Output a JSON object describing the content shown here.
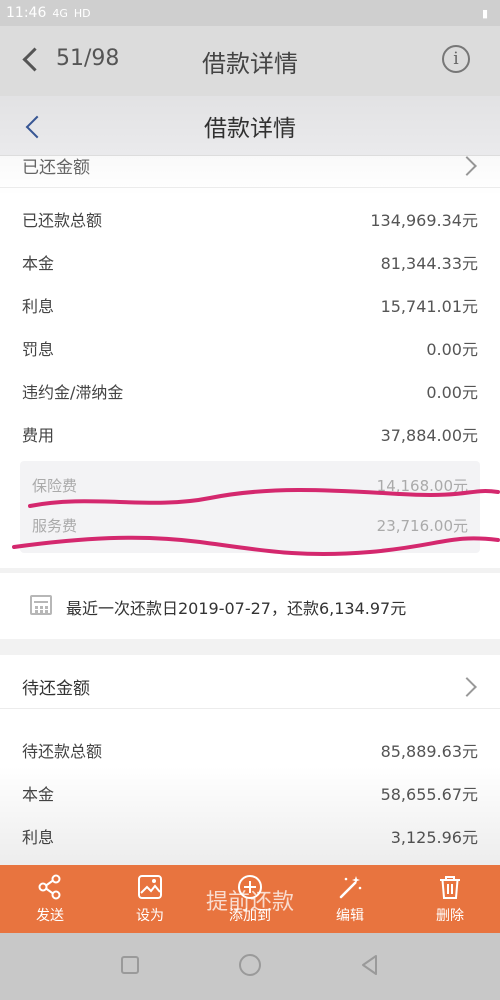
{
  "statusbar": {
    "time": "11:46",
    "network": "4G",
    "hd": "HD"
  },
  "viewer": {
    "count": "51/98",
    "title": "借款详情",
    "info": "i"
  },
  "app": {
    "title": "借款详情"
  },
  "repaid": {
    "header": "已还金额",
    "rows": [
      {
        "label": "已还款总额",
        "value": "134,969.34元"
      },
      {
        "label": "本金",
        "value": "81,344.33元"
      },
      {
        "label": "利息",
        "value": "15,741.01元"
      },
      {
        "label": "罚息",
        "value": "0.00元"
      },
      {
        "label": "违约金/滞纳金",
        "value": "0.00元"
      },
      {
        "label": "费用",
        "value": "37,884.00元"
      }
    ],
    "fees": [
      {
        "label": "保险费",
        "value": "14,168.00元"
      },
      {
        "label": "服务费",
        "value": "23,716.00元"
      }
    ]
  },
  "recent": {
    "text": "最近一次还款日2019-07-27，还款6,134.97元"
  },
  "pending": {
    "header": "待还金额",
    "rows": [
      {
        "label": "待还款总额",
        "value": "85,889.63元"
      },
      {
        "label": "本金",
        "value": "58,655.67元"
      },
      {
        "label": "利息",
        "value": "3,125.96元"
      }
    ]
  },
  "cta": {
    "label": "提前还款"
  },
  "toolbar": {
    "items": [
      {
        "label": "发送",
        "icon": "share-icon"
      },
      {
        "label": "设为",
        "icon": "set-as-icon"
      },
      {
        "label": "添加到",
        "icon": "add-icon"
      },
      {
        "label": "编辑",
        "icon": "magic-edit-icon"
      },
      {
        "label": "删除",
        "icon": "trash-icon"
      }
    ]
  },
  "colors": {
    "accent": "#e8743f",
    "annotation": "#d4286e"
  }
}
